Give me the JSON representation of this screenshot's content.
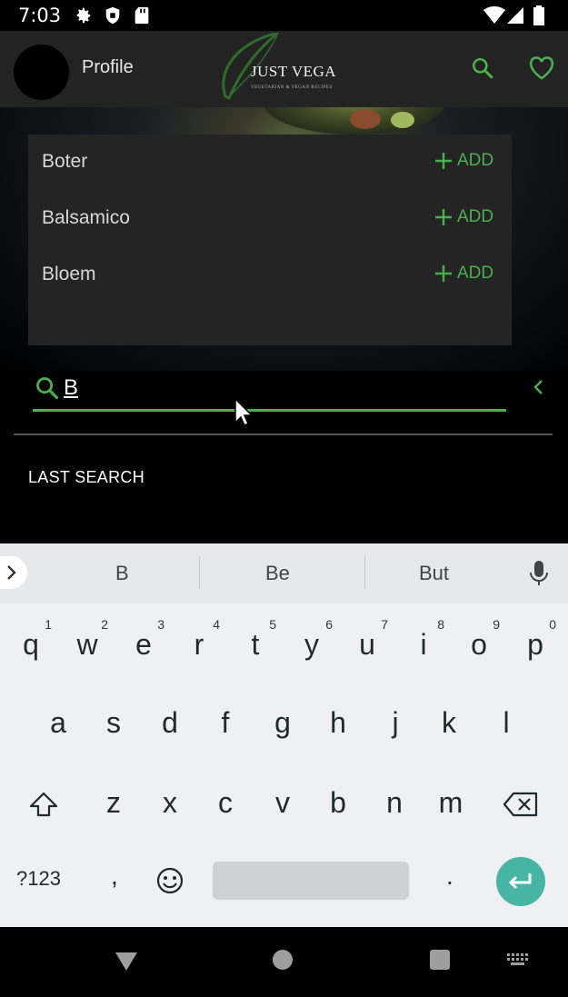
{
  "status_bar": {
    "time": "7:03",
    "icons": [
      "gear-icon",
      "shield-icon",
      "sd-card-icon",
      "wifi-icon",
      "signal-icon",
      "battery-icon"
    ]
  },
  "app_bar": {
    "profile_label": "Profile",
    "logo_text": "JUST VEGA",
    "logo_tagline": "VEGETARIAN & VEGAN RECIPES",
    "icons": [
      "search-icon",
      "heart-icon"
    ],
    "background": "#232323",
    "accent": "#4caf50"
  },
  "suggestions_dropdown": {
    "items": [
      {
        "name": "Boter",
        "action": "ADD"
      },
      {
        "name": "Balsamico",
        "action": "ADD"
      },
      {
        "name": "Bloem",
        "action": "ADD"
      }
    ]
  },
  "search": {
    "value": "B"
  },
  "last_search_label": "LAST SEARCH",
  "keyboard": {
    "suggestions": [
      "B",
      "Be",
      "But"
    ],
    "row1": [
      {
        "key": "q",
        "hint": "1"
      },
      {
        "key": "w",
        "hint": "2"
      },
      {
        "key": "e",
        "hint": "3"
      },
      {
        "key": "r",
        "hint": "4"
      },
      {
        "key": "t",
        "hint": "5"
      },
      {
        "key": "y",
        "hint": "6"
      },
      {
        "key": "u",
        "hint": "7"
      },
      {
        "key": "i",
        "hint": "8"
      },
      {
        "key": "o",
        "hint": "9"
      },
      {
        "key": "p",
        "hint": "0"
      }
    ],
    "row2": [
      "a",
      "s",
      "d",
      "f",
      "g",
      "h",
      "j",
      "k",
      "l"
    ],
    "row3": [
      "z",
      "x",
      "c",
      "v",
      "b",
      "n",
      "m"
    ],
    "symbols_label": "?123",
    "comma": ",",
    "period": ".",
    "enter_color": "#48b4a4"
  }
}
